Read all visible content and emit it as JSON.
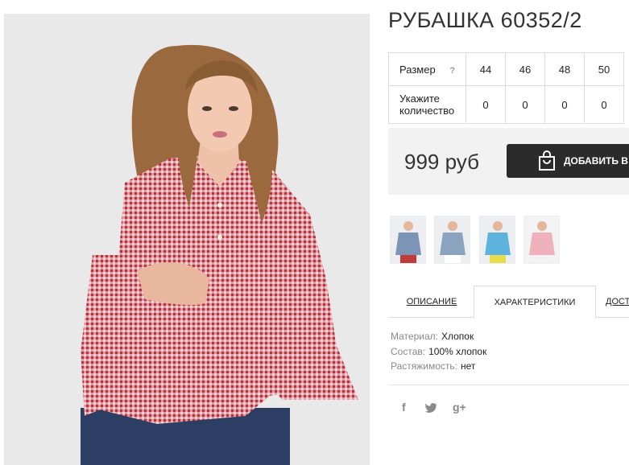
{
  "product": {
    "title": "РУБАШКА 60352/2",
    "price": "999 руб",
    "add_to_cart_label": "ДОБАВИТЬ В ЗАКАЗ"
  },
  "size_table": {
    "size_label": "Размер",
    "help_symbol": "?",
    "sizes": [
      "44",
      "46",
      "48",
      "50"
    ],
    "quantity_label": "Укажите количество",
    "quantities": [
      "0",
      "0",
      "0",
      "0"
    ]
  },
  "thumbnails": [
    {
      "name": "thumb-blue-striped",
      "shirt_color": "#7c95b6"
    },
    {
      "name": "thumb-blue-gingham",
      "shirt_color": "#8aa4c0"
    },
    {
      "name": "thumb-sky-blue",
      "shirt_color": "#5eb3de"
    },
    {
      "name": "thumb-pink",
      "shirt_color": "#efb2bd"
    }
  ],
  "tabs": {
    "description": "ОПИСАНИЕ",
    "characteristics": "ХАРАКТЕРИСТИКИ",
    "delivery": "ДОСТАВКА"
  },
  "characteristics": [
    {
      "key": "Материал:",
      "value": "Хлопок"
    },
    {
      "key": "Состав:",
      "value": "100% хлопок"
    },
    {
      "key": "Растяжимость:",
      "value": "нет"
    }
  ],
  "share": {
    "facebook": "f",
    "twitter": "🐦",
    "google": "g+"
  },
  "colors": {
    "shirt_red": "#c9444d",
    "button_dark": "#2b2b2b",
    "price_bg": "#f2f2f2"
  }
}
